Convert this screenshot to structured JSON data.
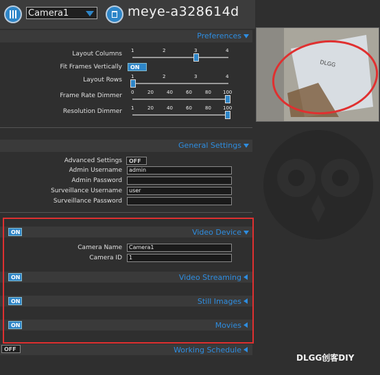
{
  "header": {
    "camera_select": "Camera1",
    "title": "meye-a328614d"
  },
  "preferences": {
    "header": "Preferences",
    "layout_columns": {
      "label": "Layout Columns",
      "ticks": [
        "1",
        "2",
        "3",
        "4"
      ],
      "value": 3
    },
    "fit_frames": {
      "label": "Fit Frames Vertically",
      "toggle": "ON"
    },
    "layout_rows": {
      "label": "Layout Rows",
      "ticks": [
        "1",
        "2",
        "3",
        "4"
      ],
      "value": 1
    },
    "frame_rate_dimmer": {
      "label": "Frame Rate Dimmer",
      "ticks": [
        "0",
        "20",
        "40",
        "60",
        "80",
        "100"
      ],
      "value": 100
    },
    "resolution_dimmer": {
      "label": "Resolution Dimmer",
      "ticks": [
        "1",
        "20",
        "40",
        "60",
        "80",
        "100"
      ],
      "value": 100
    }
  },
  "general": {
    "header": "General Settings",
    "advanced": {
      "label": "Advanced Settings",
      "toggle": "OFF"
    },
    "admin_username": {
      "label": "Admin Username",
      "value": "admin"
    },
    "admin_password": {
      "label": "Admin Password",
      "value": ""
    },
    "surv_username": {
      "label": "Surveillance Username",
      "value": "user"
    },
    "surv_password": {
      "label": "Surveillance Password",
      "value": ""
    }
  },
  "video_device": {
    "toggle": "ON",
    "header": "Video Device",
    "camera_name": {
      "label": "Camera Name",
      "value": "Camera1"
    },
    "camera_id": {
      "label": "Camera ID",
      "value": "1"
    }
  },
  "video_streaming": {
    "toggle": "ON",
    "header": "Video Streaming"
  },
  "still_images": {
    "toggle": "ON",
    "header": "Still Images"
  },
  "movies": {
    "toggle": "ON",
    "header": "Movies"
  },
  "working_schedule": {
    "toggle": "OFF",
    "header": "Working Schedule"
  },
  "watermark": {
    "text": "DLGG创客DIY"
  },
  "colors": {
    "accent": "#2e86c8",
    "highlight": "#e03030"
  }
}
